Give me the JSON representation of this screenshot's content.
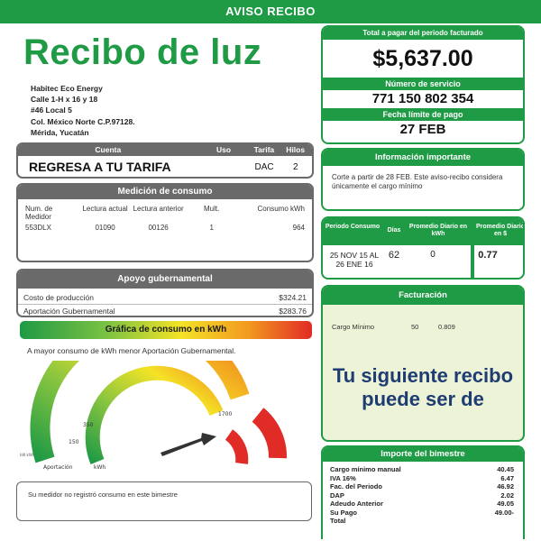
{
  "header": {
    "banner": "AVISO RECIBO",
    "title": "Recibo de luz"
  },
  "address": {
    "lines": [
      "Habitec Eco Energy",
      "Calle 1-H x 16 y 18",
      "#46 Local 5",
      "Col. México Norte C.P.97128.",
      "Mérida, Yucatán"
    ]
  },
  "cuenta": {
    "headers": [
      "Cuenta",
      "Uso",
      "Tarifa",
      "Hilos"
    ],
    "cuenta_value": "REGRESA A TU TARIFA",
    "uso_value": "",
    "tarifa_value": "DAC",
    "hilos_value": "2"
  },
  "medicion": {
    "title": "Medición de consumo",
    "headers": [
      "Num. de Medidor",
      "Lectura actual",
      "Lectura anterior",
      "Mult.",
      "Consumo kWh"
    ],
    "values": [
      "553DLX",
      "01090",
      "00126",
      "1",
      "964"
    ]
  },
  "apoyo": {
    "title": "Apoyo gubernamental",
    "rows": [
      {
        "label": "Costo de producción",
        "value": "$324.21"
      },
      {
        "label": "Aportación Gubernamental",
        "value": "$283.76"
      }
    ]
  },
  "grafica": {
    "title": "Gráfica de consumo en kWh",
    "note": "A mayor consumo de kWh menor Aportación Gubernamental.",
    "labels": {
      "l350": "350",
      "l150": "150",
      "l1700": "1700",
      "aportacion": "Aportación",
      "kwh": "kWh",
      "tiny": "kW kWh"
    },
    "colors": {
      "green": "#1f9a45",
      "yellow": "#f4e326",
      "orange": "#f29a1f",
      "red": "#e12b26"
    }
  },
  "nota": {
    "text": "Su medidor no registró consumo en este bimestre"
  },
  "total": {
    "label": "Total a pagar del periodo facturado",
    "amount": "$5,637.00",
    "servicio_label": "Número de servicio",
    "servicio_value": "771 150 802 354",
    "fecha_label": "Fecha límite de pago",
    "fecha_value": "27 FEB"
  },
  "info": {
    "title": "Información importante",
    "text": "Corte a partir de 28 FEB. Este aviso-recibo considera únicamente el cargo mínimo"
  },
  "periodo": {
    "headers": {
      "periodo": "Periodo Consumo",
      "dias": "Días",
      "promedio": "Promedio Diario en kWh",
      "promedio_dinero": "Promedio Diario en $"
    },
    "periodo_value": "25 NOV 15 AL 26 ENE 16",
    "dias_value": "62",
    "promedio_value": "0",
    "promedio_dinero_value": "0.77"
  },
  "facturacion": {
    "title": "Facturación",
    "row": {
      "label": "Cargo Mínimo",
      "value1": "50",
      "value2": "0.809"
    },
    "siguiente": "Tu siguiente recibo puede ser de"
  },
  "importe": {
    "title": "Importe del bimestre",
    "rows": [
      {
        "label": "Cargo mínimo manual",
        "value": "40.45"
      },
      {
        "label": "IVA 16%",
        "value": "6.47"
      },
      {
        "label": "Fac. del Periodo",
        "value": "46.92"
      },
      {
        "label": "DAP",
        "value": "2.02"
      },
      {
        "label": "Adeudo Anterior",
        "value": "49.05"
      },
      {
        "label": "Su Pago",
        "value": "49.00-"
      },
      {
        "label": "Total",
        "value": ""
      }
    ]
  }
}
